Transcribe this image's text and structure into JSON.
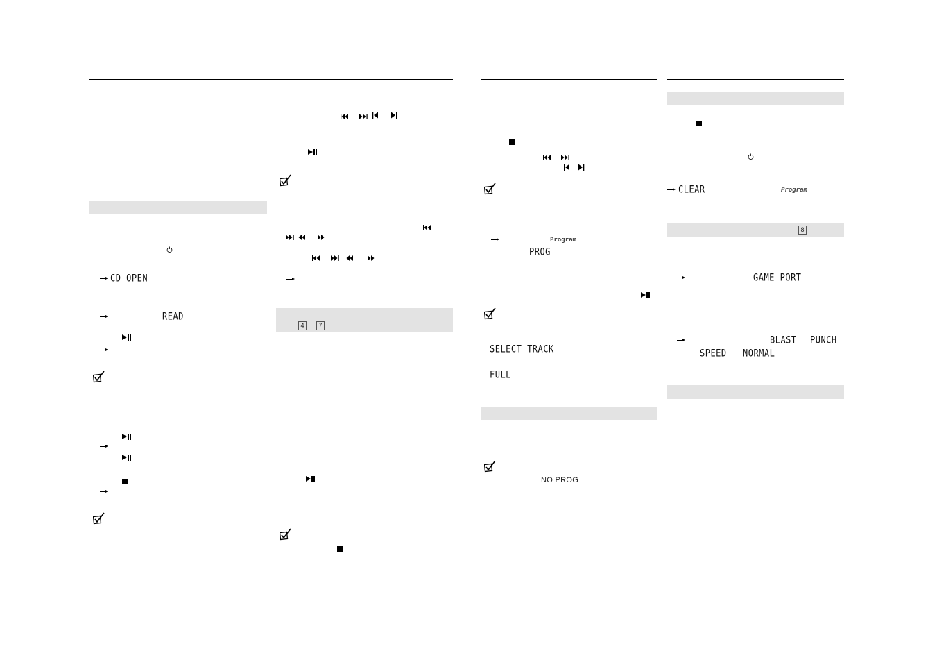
{
  "document": {
    "type": "instruction-manual-pages",
    "text_visible": false
  },
  "column1": {
    "displays": {
      "cd_open": "CD OPEN",
      "read": "READ"
    }
  },
  "column2": {
    "keys": {
      "key_a": "4",
      "key_b": "7"
    }
  },
  "column3": {
    "displays": {
      "program_indicator": "Program",
      "prog": "PROG",
      "select_track": "SELECT TRACK",
      "full": "FULL",
      "no_prog": "NO PROG"
    }
  },
  "column4": {
    "displays": {
      "clear": "CLEAR",
      "program_indicator": "Program",
      "game_port": "GAME PORT",
      "blast": "BLAST",
      "punch": "PUNCH",
      "speed": "SPEED",
      "normal": "NORMAL"
    },
    "keys": {
      "key_c": "8"
    }
  },
  "colors": {
    "band": "#e3e3e3",
    "rule": "#000000"
  }
}
